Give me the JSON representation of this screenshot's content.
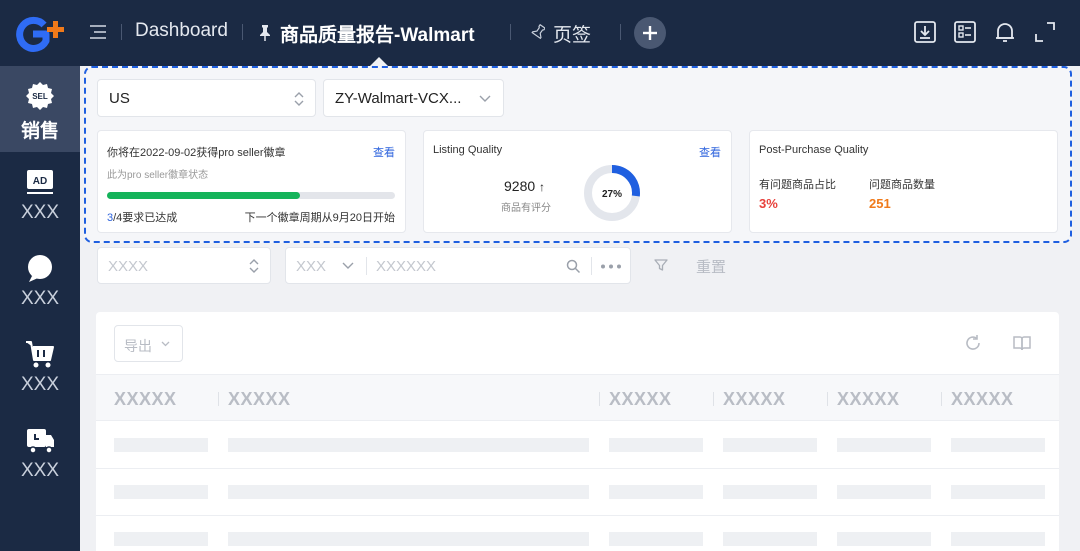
{
  "topbar": {
    "dashboard": "Dashboard",
    "report_title": "商品质量报告-Walmart",
    "bookmark": "页签"
  },
  "sidebar": {
    "items": [
      {
        "label": "销售",
        "icon": "sel-badge-icon",
        "badge": "SEL",
        "active": true
      },
      {
        "label": "XXX",
        "icon": "ad-icon",
        "badge": "AD",
        "active": false
      },
      {
        "label": "XXX",
        "icon": "chat-bubble-icon",
        "active": false
      },
      {
        "label": "XXX",
        "icon": "shopping-cart-icon",
        "active": false
      },
      {
        "label": "XXX",
        "icon": "delivery-truck-icon",
        "active": false
      }
    ]
  },
  "filters": {
    "country": "US",
    "store": "ZY-Walmart-VCX..."
  },
  "cards": {
    "seller": {
      "title": "你将在2022-09-02获得pro seller徽章",
      "link": "查看",
      "subtitle": "此为pro seller徽章状态",
      "progress": 0.67,
      "done": "3",
      "total_text": "/4要求已达成",
      "next_cycle": "下一个徽章周期从9月20日开始"
    },
    "listing": {
      "title": "Listing Quality",
      "link": "查看",
      "count": "9280",
      "count_label": "商品有评分",
      "percent_label": "27%",
      "percent": 27
    },
    "post_purchase": {
      "title": "Post-Purchase Quality",
      "ratio_label": "有问题商品占比",
      "ratio_value": "3%",
      "count_label": "问题商品数量",
      "count_value": "251"
    }
  },
  "search": {
    "select1": "XXXX",
    "select2": "XXX",
    "input": "XXXXXX",
    "reset": "重置"
  },
  "table": {
    "export": "导出",
    "columns": [
      "XXXXX",
      "XXXXX",
      "XXXXX",
      "XXXXX",
      "XXXXX",
      "XXXXX"
    ]
  },
  "colors": {
    "accent_blue": "#1f5fe0",
    "progress_green": "#14b35a",
    "red": "#e8413c",
    "orange": "#f07a1a",
    "nav_bg": "#1b2a44"
  }
}
